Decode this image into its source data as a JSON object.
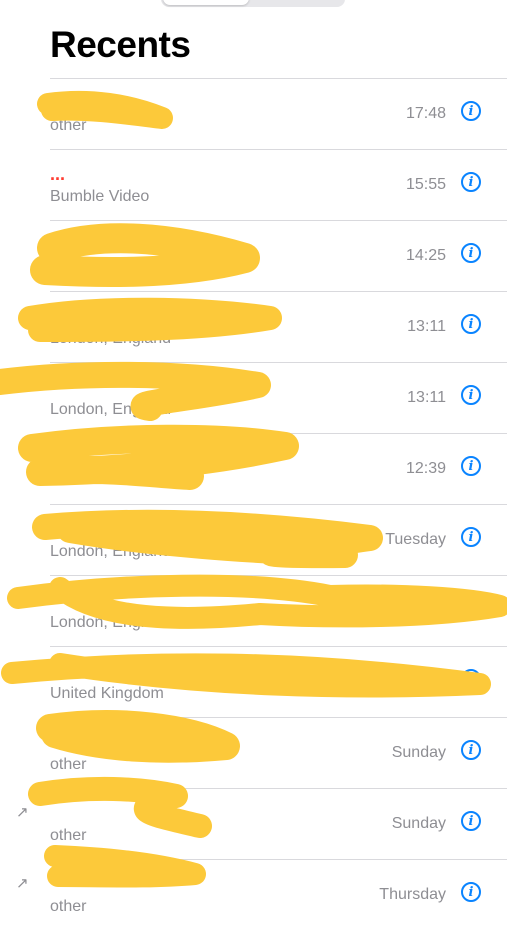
{
  "header": {
    "title": "Recents"
  },
  "calls": [
    {
      "name": "",
      "missed": false,
      "subtitle": "other",
      "time": "17:48",
      "outgoing": false
    },
    {
      "name": "...",
      "missed": true,
      "subtitle": "Bumble Video",
      "time": "15:55",
      "outgoing": false
    },
    {
      "name": "",
      "missed": true,
      "subtitle": "",
      "time": "14:25",
      "outgoing": false
    },
    {
      "name": "",
      "missed": false,
      "subtitle": "London, England",
      "time": "13:11",
      "outgoing": false
    },
    {
      "name": "",
      "missed": false,
      "subtitle": "London, England",
      "time": "13:11",
      "outgoing": false
    },
    {
      "name": "",
      "missed": false,
      "subtitle": "",
      "time": "12:39",
      "outgoing": false
    },
    {
      "name": "",
      "missed": false,
      "subtitle": "London, England",
      "time": "Tuesday",
      "outgoing": false
    },
    {
      "name": "",
      "missed": false,
      "subtitle": "London, England",
      "time": "Tuesday",
      "outgoing": false
    },
    {
      "name": "",
      "missed": false,
      "subtitle": "United Kingdom",
      "time": "",
      "outgoing": false
    },
    {
      "name": "",
      "missed": false,
      "subtitle": "other",
      "time": "Sunday",
      "outgoing": false
    },
    {
      "name": "",
      "missed": false,
      "subtitle": "other",
      "time": "Sunday",
      "outgoing": true
    },
    {
      "name": "",
      "missed": false,
      "subtitle": "other",
      "time": "Thursday",
      "outgoing": true
    }
  ],
  "icons": {
    "info": "info-circle-icon",
    "outgoing": "outgoing-call-icon"
  },
  "colors": {
    "accent": "#0a84ff",
    "missed": "#ff3b30",
    "secondary": "#8e8e93",
    "redaction": "#fcc93a"
  }
}
